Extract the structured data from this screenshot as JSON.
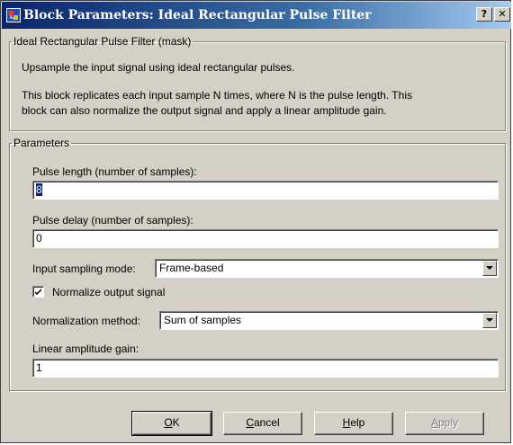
{
  "window": {
    "title": "Block Parameters: Ideal Rectangular Pulse Filter",
    "help_label": "?",
    "close_label": "✕"
  },
  "description": {
    "legend": "Ideal Rectangular Pulse Filter (mask)",
    "line1": "Upsample the input signal using ideal rectangular pulses.",
    "line2": "This block replicates each input sample N times, where N is the pulse length. This",
    "line3": "block can also normalize the output signal and apply a linear amplitude gain."
  },
  "parameters": {
    "legend": "Parameters",
    "pulse_length": {
      "label": "Pulse length (number of samples):",
      "value": "8"
    },
    "pulse_delay": {
      "label": "Pulse delay (number of samples):",
      "value": "0"
    },
    "input_sampling_mode": {
      "label": "Input sampling mode:",
      "value": "Frame-based"
    },
    "normalize": {
      "label": "Normalize output signal",
      "checked": true
    },
    "normalization_method": {
      "label": "Normalization method:",
      "value": "Sum of samples"
    },
    "linear_gain": {
      "label": "Linear amplitude gain:",
      "value": "1"
    }
  },
  "buttons": {
    "ok": {
      "mnemonic": "O",
      "rest": "K"
    },
    "cancel": {
      "mnemonic": "C",
      "rest": "ancel"
    },
    "help": {
      "mnemonic": "H",
      "rest": "elp"
    },
    "apply": {
      "mnemonic": "A",
      "rest": "pply"
    }
  },
  "colors": {
    "title_bar": "#0a246a",
    "dialog_face": "#d4d0c8",
    "selection": "#0a246a"
  }
}
